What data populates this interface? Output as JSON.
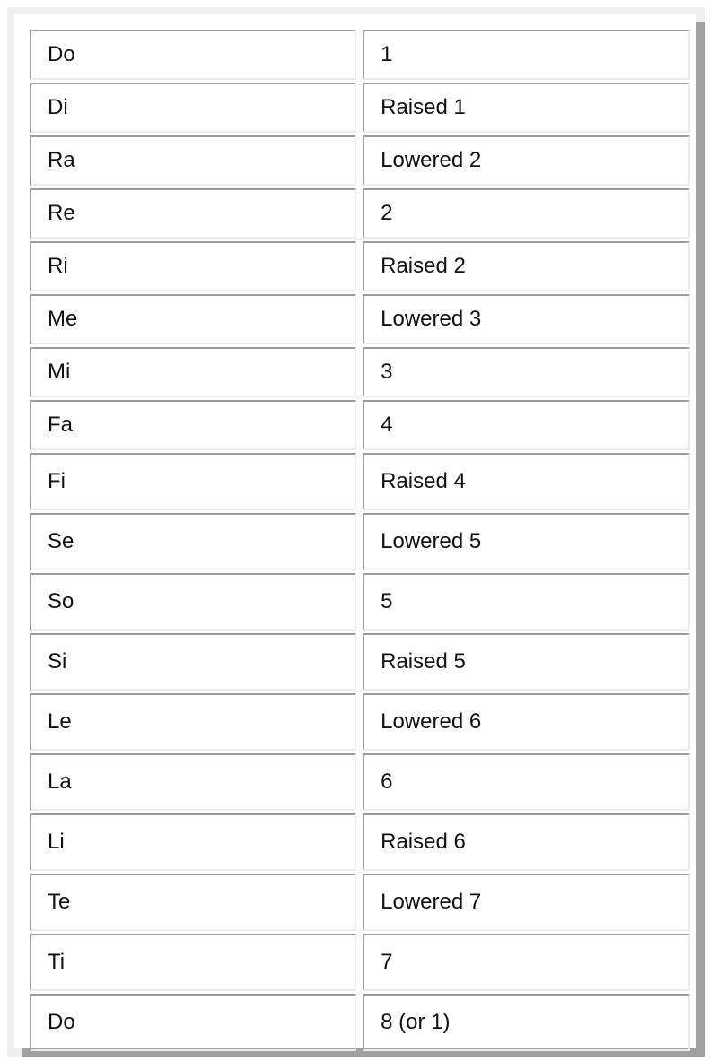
{
  "rows": [
    {
      "syllable": "Do",
      "degree": "1"
    },
    {
      "syllable": "Di",
      "degree": "Raised 1"
    },
    {
      "syllable": "Ra",
      "degree": "Lowered 2"
    },
    {
      "syllable": "Re",
      "degree": "2"
    },
    {
      "syllable": "Ri",
      "degree": "Raised 2"
    },
    {
      "syllable": "Me",
      "degree": "Lowered 3"
    },
    {
      "syllable": "Mi",
      "degree": "3"
    },
    {
      "syllable": "Fa",
      "degree": "4"
    },
    {
      "syllable": "Fi",
      "degree": "Raised 4"
    },
    {
      "syllable": "Se",
      "degree": "Lowered 5"
    },
    {
      "syllable": "So",
      "degree": "5"
    },
    {
      "syllable": "Si",
      "degree": "Raised 5"
    },
    {
      "syllable": "Le",
      "degree": "Lowered 6"
    },
    {
      "syllable": "La",
      "degree": "6"
    },
    {
      "syllable": "Li",
      "degree": "Raised 6"
    },
    {
      "syllable": "Te",
      "degree": "Lowered 7"
    },
    {
      "syllable": "Ti",
      "degree": "7"
    },
    {
      "syllable": "Do",
      "degree": "8 (or 1)"
    }
  ]
}
